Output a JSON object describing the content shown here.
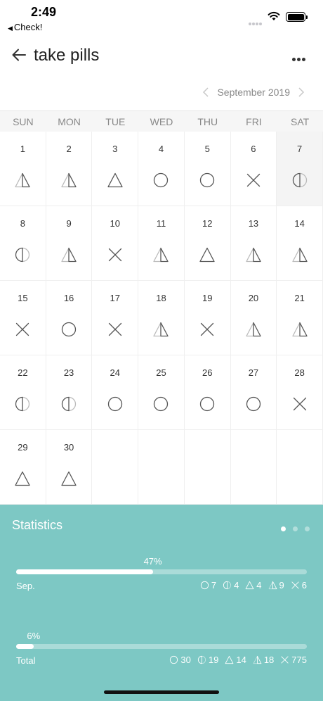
{
  "status_bar": {
    "time": "2:49",
    "back_app": "Check!"
  },
  "header": {
    "title": "take pills"
  },
  "calendar": {
    "month_label": "September 2019",
    "weekdays": [
      "SUN",
      "MON",
      "TUE",
      "WED",
      "THU",
      "FRI",
      "SAT"
    ],
    "today": 7,
    "days": [
      {
        "day": "1",
        "mark": "half-triangle"
      },
      {
        "day": "2",
        "mark": "half-triangle"
      },
      {
        "day": "3",
        "mark": "triangle"
      },
      {
        "day": "4",
        "mark": "circle"
      },
      {
        "day": "5",
        "mark": "circle"
      },
      {
        "day": "6",
        "mark": "cross"
      },
      {
        "day": "7",
        "mark": "half-circle"
      },
      {
        "day": "8",
        "mark": "half-circle"
      },
      {
        "day": "9",
        "mark": "half-triangle"
      },
      {
        "day": "10",
        "mark": "cross"
      },
      {
        "day": "11",
        "mark": "half-triangle"
      },
      {
        "day": "12",
        "mark": "triangle"
      },
      {
        "day": "13",
        "mark": "half-triangle"
      },
      {
        "day": "14",
        "mark": "half-triangle"
      },
      {
        "day": "15",
        "mark": "cross"
      },
      {
        "day": "16",
        "mark": "circle"
      },
      {
        "day": "17",
        "mark": "cross"
      },
      {
        "day": "18",
        "mark": "half-triangle"
      },
      {
        "day": "19",
        "mark": "cross"
      },
      {
        "day": "20",
        "mark": "half-triangle"
      },
      {
        "day": "21",
        "mark": "half-triangle"
      },
      {
        "day": "22",
        "mark": "half-circle"
      },
      {
        "day": "23",
        "mark": "half-circle"
      },
      {
        "day": "24",
        "mark": "circle"
      },
      {
        "day": "25",
        "mark": "circle"
      },
      {
        "day": "26",
        "mark": "circle"
      },
      {
        "day": "27",
        "mark": "circle"
      },
      {
        "day": "28",
        "mark": "cross"
      },
      {
        "day": "29",
        "mark": "triangle"
      },
      {
        "day": "30",
        "mark": "triangle"
      }
    ]
  },
  "statistics": {
    "title": "Statistics",
    "rows": [
      {
        "label": "Sep.",
        "percent_label": "47%",
        "progress": 0.47,
        "counts": [
          {
            "icon": "circle",
            "value": "7"
          },
          {
            "icon": "half-circle",
            "value": "4"
          },
          {
            "icon": "triangle",
            "value": "4"
          },
          {
            "icon": "half-triangle",
            "value": "9"
          },
          {
            "icon": "cross",
            "value": "6"
          }
        ]
      },
      {
        "label": "Total",
        "percent_label": "6%",
        "progress": 0.06,
        "counts": [
          {
            "icon": "circle",
            "value": "30"
          },
          {
            "icon": "half-circle",
            "value": "19"
          },
          {
            "icon": "triangle",
            "value": "14"
          },
          {
            "icon": "half-triangle",
            "value": "18"
          },
          {
            "icon": "cross",
            "value": "775"
          }
        ]
      }
    ]
  }
}
